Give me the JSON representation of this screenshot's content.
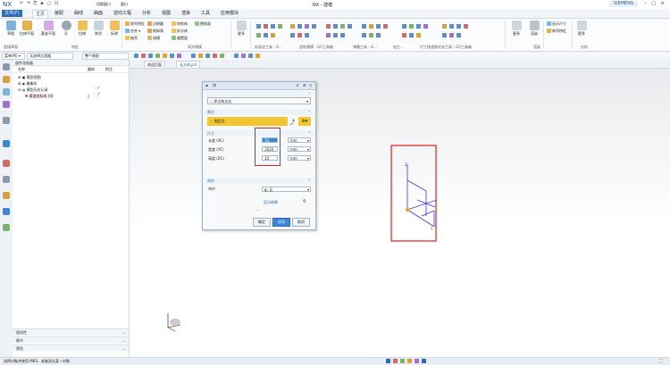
{
  "app": {
    "logo": "NX",
    "window_title": "NX - 建模",
    "quick_access": "↶ ↷ ⎘ ◈ ▢ ⊡",
    "switch_window": "切换窗口",
    "window_menu": "窗口",
    "brand": "SIEMENS",
    "min": "–",
    "max": "□",
    "close": "×"
  },
  "ribbon_tabs": [
    {
      "label": "文件(F)"
    },
    {
      "label": "主页"
    },
    {
      "label": "装配"
    },
    {
      "label": "曲线"
    },
    {
      "label": "曲面"
    },
    {
      "label": "逆向工程"
    },
    {
      "label": "分析"
    },
    {
      "label": "视图"
    },
    {
      "label": "渲染"
    },
    {
      "label": "工具"
    },
    {
      "label": "应用模块"
    }
  ],
  "ribbon": {
    "big_buttons": [
      "草图",
      "拉伸平面",
      "基准平面",
      "孔",
      "拉伸",
      "阵列",
      "拆除"
    ],
    "small_rows": [
      "阵列特征",
      "合并 ▾",
      "抽壳",
      "边倒圆",
      "倒斜角",
      "拔模",
      "修剪体",
      "拆分体",
      "偏置面",
      "替换面"
    ],
    "groups": [
      "直接草图",
      "特征",
      "同步建模",
      "标准化工具 - G...",
      "齿轮建模 - GC工具箱",
      "弹簧工具 - G...",
      "加工...",
      "尺寸快速格式化工具 - GC工具箱",
      "渲染",
      "分析"
    ],
    "right_buttons": [
      "更多",
      "渲染",
      "显示尺寸",
      "更多"
    ]
  },
  "toolbar2": {
    "menu": "菜单(M) ▾",
    "filter": "无选择过滤器",
    "scope": "整个装配",
    "icons": [
      "snap-icon",
      "point-icon",
      "end-icon",
      "mid-icon",
      "center-icon",
      "tangent-icon",
      "grid-icon"
    ]
  },
  "navigator": {
    "header": "部件导航器",
    "columns": [
      "名称",
      "最新",
      "附注"
    ],
    "tree": [
      {
        "label": "模型视图",
        "checked": false
      },
      {
        "label": "摄像机",
        "checked": false
      },
      {
        "label": "模型历史记录",
        "checked": true
      },
      {
        "label": "基准坐标系 (0)",
        "checked": true
      }
    ],
    "accordions": [
      "相关性",
      "细节",
      "预览"
    ]
  },
  "doc_tabs": [
    {
      "label": "欢迎页面",
      "active": false
    },
    {
      "label": "长方体.prt",
      "active": true
    }
  ],
  "dialog": {
    "title": "块",
    "type_value": "原点和边长",
    "origin_section": "原点",
    "origin_label": "指定点",
    "dims_section": "尺寸",
    "fields": [
      {
        "label": "长度 (XC)",
        "value": "10",
        "unit": "mm"
      },
      {
        "label": "宽度 (YC)",
        "value": "1620",
        "unit": "mm"
      },
      {
        "label": "高度 (ZC)",
        "value": "10",
        "unit": "mm"
      }
    ],
    "bool_section": "布尔",
    "bool_label": "布尔",
    "bool_value": "无",
    "preview_label": "显示结果",
    "ok": "确定",
    "apply": "应用",
    "cancel": "取消"
  },
  "status": {
    "message": "选择对象并使用 MB3，或者双击某一对象"
  },
  "colors": {
    "highlight_red": "#e02020",
    "accent_blue": "#2d6cb5",
    "gold": "#f2c531"
  }
}
